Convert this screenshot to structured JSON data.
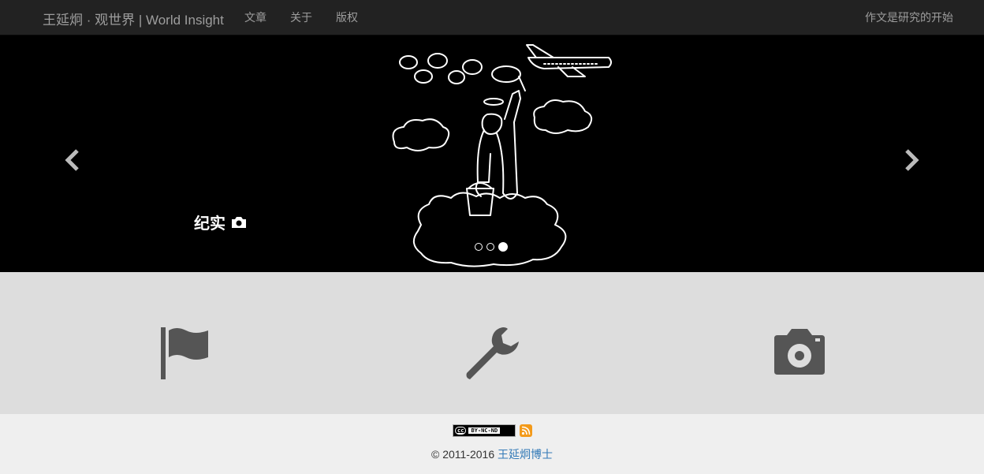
{
  "navbar": {
    "brand": "王延炯 · 观世界 | World Insight",
    "links": [
      "文章",
      "关于",
      "版权"
    ],
    "right_link": "作文是研究的开始"
  },
  "carousel": {
    "caption": "纪实",
    "caption_icon": "camera-icon",
    "indicators_total": 3,
    "active_index": 2
  },
  "features": {
    "icons": [
      "flag-icon",
      "wrench-icon",
      "camera-icon"
    ]
  },
  "footer": {
    "license_badge": "BY-NC-ND",
    "license_cc": "cc",
    "copyright_prefix": "© 2011-2016",
    "author_link": "王延炯博士"
  },
  "colors": {
    "navbar_bg": "#222222",
    "nav_text": "#9d9d9d",
    "features_bg": "#dddddd",
    "footer_bg": "#efefef",
    "link": "#337ab7",
    "icon": "#555555"
  }
}
